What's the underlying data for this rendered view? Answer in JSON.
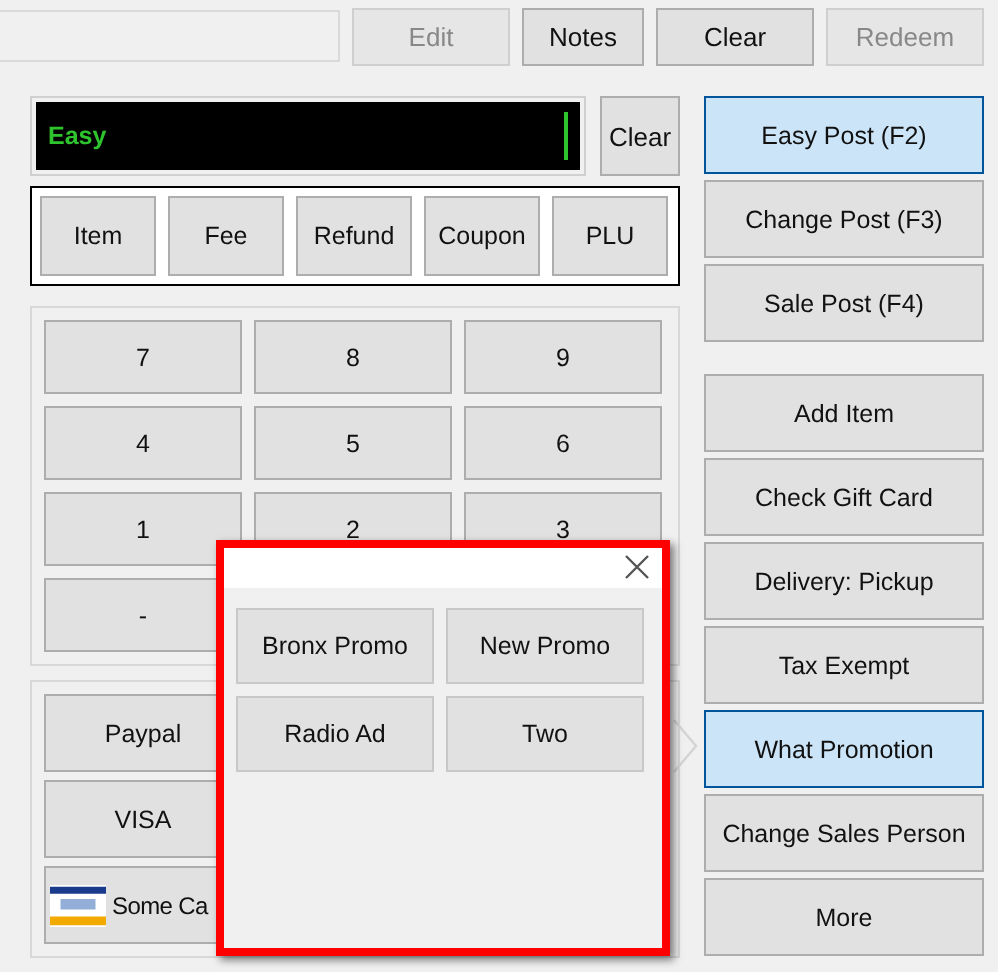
{
  "toolbar": {
    "buttons": [
      {
        "label": "Edit",
        "disabled": true
      },
      {
        "label": "Notes",
        "disabled": false
      },
      {
        "label": "Clear",
        "disabled": false
      },
      {
        "label": "Redeem",
        "disabled": true
      }
    ]
  },
  "display": {
    "value": "Easy",
    "clear": "Clear"
  },
  "modes": [
    "Item",
    "Fee",
    "Refund",
    "Coupon",
    "PLU"
  ],
  "keypad": [
    "7",
    "8",
    "9",
    "4",
    "5",
    "6",
    "1",
    "2",
    "3",
    "-"
  ],
  "payments": [
    {
      "label": "Paypal",
      "kind": "text"
    },
    {
      "label": "VISA",
      "kind": "text"
    },
    {
      "label": "Some Ca",
      "kind": "card"
    }
  ],
  "post_buttons": [
    {
      "label": "Easy Post (F2)",
      "selected": true
    },
    {
      "label": "Change Post (F3)",
      "selected": false
    },
    {
      "label": "Sale Post (F4)",
      "selected": false
    }
  ],
  "actions": [
    {
      "label": "Add Item",
      "selected": false
    },
    {
      "label": "Check Gift Card",
      "selected": false
    },
    {
      "label": "Delivery: Pickup",
      "selected": false
    },
    {
      "label": "Tax Exempt",
      "selected": false
    },
    {
      "label": "What Promotion",
      "selected": true
    },
    {
      "label": "Change Sales Person",
      "selected": false
    },
    {
      "label": "More",
      "selected": false
    }
  ],
  "popup": {
    "promotions": [
      "Bronx Promo",
      "New Promo",
      "Radio Ad",
      "Two"
    ]
  }
}
